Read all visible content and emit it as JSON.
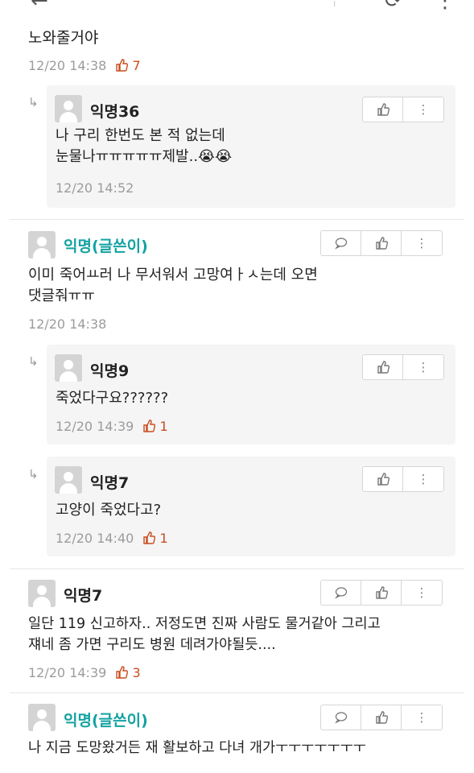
{
  "topbar": {
    "back_icon": "←",
    "translate_icon": "ᴵ",
    "refresh_icon": "⟳",
    "more_icon": "⋮"
  },
  "first": {
    "text_partial": "노와줄거야",
    "time": "12/20 14:38",
    "likes": "7"
  },
  "comments": [
    {
      "id": "r1",
      "name": "익명36",
      "text": "나 구리 한번도 본 적 없는데\n눈물나ㅠㅠㅠㅠㅠ제발..😭😭",
      "time": "12/20 14:52",
      "likes": ""
    },
    {
      "id": "c1",
      "name": "익명(글쓴이)",
      "text": "이미 죽어ㅛ러 나 무서워서 고망여ㅏㅅ는데 오면\n댓글줘ㅠㅠ",
      "time": "12/20 14:38",
      "likes": ""
    },
    {
      "id": "r2",
      "name": "익명9",
      "text": "죽었다구요??????",
      "time": "12/20 14:39",
      "likes": "1"
    },
    {
      "id": "r3",
      "name": "익명7",
      "text": "고양이 죽었다고?",
      "time": "12/20 14:40",
      "likes": "1"
    },
    {
      "id": "c2",
      "name": "익명7",
      "text": "일단 119 신고하자.. 저정도면 진짜 사람도 물거같아 그리고\n쟤네 좀 가면 구리도 병원 데려가야될듯....",
      "time": "12/20 14:39",
      "likes": "3"
    },
    {
      "id": "c3",
      "name": "익명(글쓴이)",
      "text": "나 지금 도망왔거든 재 활보하고 다녀 개가ㅜㅜㅜㅜㅜㅜㅜ",
      "time": "",
      "likes": ""
    }
  ],
  "colors": {
    "op_name": "#15a2a2",
    "like": "#c94c1d",
    "meta": "#9c9c9c"
  },
  "icons": {
    "reply": "↳",
    "comment": "comment-icon",
    "like": "thumbs-up-icon",
    "more": "⋮"
  }
}
